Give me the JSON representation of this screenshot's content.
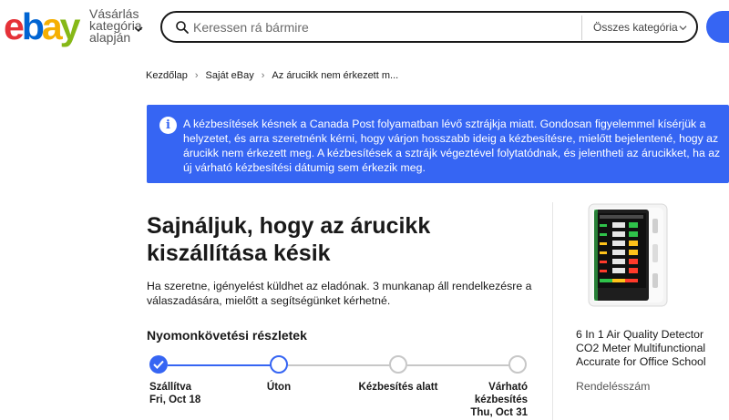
{
  "header": {
    "logo_letters": [
      "e",
      "b",
      "a",
      "y"
    ],
    "shop_by_label": "Vásárlás kategória alapján",
    "search_placeholder": "Keressen rá bármire",
    "category_label": "Összes kategória"
  },
  "breadcrumb": {
    "home": "Kezdőlap",
    "my_ebay": "Saját eBay",
    "current": "Az árucikk nem érkezett m..."
  },
  "alert": {
    "text": "A kézbesítések késnek a Canada Post folyamatban lévő sztrájkja miatt. Gondosan figyelemmel kísérjük a helyzetet, és arra szeretnénk kérni, hogy várjon hosszabb ideig a kézbesítésre, mielőtt bejelentené, hogy az árucikk nem érkezett meg. A kézbesítések a sztrájk végeztével folytatódnak, és jelentheti az árucikket, ha az új várható kézbesítési dátumig sem érkezik meg."
  },
  "main": {
    "title": "Sajnáljuk, hogy az árucikk kiszállítása késik",
    "description": "Ha szeretne, igényelést küldhet az eladónak. 3 munkanap áll rendelkezésre a válaszadására, mielőtt a segítségünket kérhetné.",
    "tracking_title": "Nyomonkövetési részletek",
    "steps": [
      {
        "label": "Szállítva",
        "date": "Fri, Oct 18",
        "state": "done"
      },
      {
        "label": "Úton",
        "date": "",
        "state": "current"
      },
      {
        "label": "Kézbesítés alatt",
        "date": "",
        "state": "pending"
      },
      {
        "label": "Várható kézbesítés",
        "date": "Thu, Oct 31",
        "state": "pending"
      }
    ]
  },
  "product": {
    "title": "6 In 1 Air Quality Detector CO2 Meter Multifunctional Accurate for Office School",
    "order_details_label": "Rendelésszám"
  },
  "colors": {
    "accent": "#3665f3",
    "logo_red": "#e53238",
    "logo_blue": "#0064d2",
    "logo_yellow": "#f5af02",
    "logo_green": "#86b817"
  }
}
